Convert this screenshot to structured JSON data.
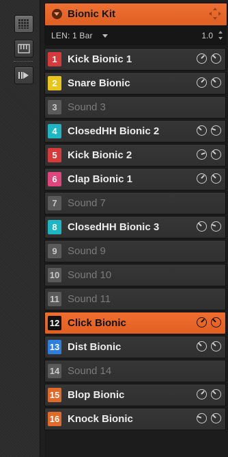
{
  "rail": {
    "buttons": [
      {
        "icon": "grid-icon",
        "active": true
      },
      {
        "icon": "keyboard-icon",
        "active": false
      },
      {
        "icon": "step-sequencer-icon",
        "active": false
      }
    ]
  },
  "header": {
    "title": "Bionic Kit",
    "expand_icon": "chevron-down-icon",
    "move_icon": "move-icon"
  },
  "lenbar": {
    "len_label": "LEN: 1 Bar",
    "value": "1.0"
  },
  "colors": {
    "accent": "#e6672a",
    "red": "#d63a3a",
    "yellow": "#e7c51d",
    "gray": "#5a5a5a",
    "cyan": "#1fb6c4",
    "pink": "#e0457c",
    "black": "#111111",
    "blue": "#2e7ee0",
    "orange": "#e06a2a"
  },
  "pads": [
    {
      "num": "1",
      "name": "Kick Bionic 1",
      "color": "#d63a3a",
      "empty": false,
      "selected": false
    },
    {
      "num": "2",
      "name": "Snare Bionic",
      "color": "#e7c51d",
      "empty": false,
      "selected": false
    },
    {
      "num": "3",
      "name": "Sound 3",
      "color": "#5a5a5a",
      "empty": true,
      "selected": false
    },
    {
      "num": "4",
      "name": "ClosedHH Bionic 2",
      "color": "#1fb6c4",
      "empty": false,
      "selected": false
    },
    {
      "num": "5",
      "name": "Kick Bionic 2",
      "color": "#d63a3a",
      "empty": false,
      "selected": false
    },
    {
      "num": "6",
      "name": "Clap Bionic 1",
      "color": "#e0457c",
      "empty": false,
      "selected": false
    },
    {
      "num": "7",
      "name": "Sound 7",
      "color": "#5a5a5a",
      "empty": true,
      "selected": false
    },
    {
      "num": "8",
      "name": "ClosedHH Bionic 3",
      "color": "#1fb6c4",
      "empty": false,
      "selected": false
    },
    {
      "num": "9",
      "name": "Sound 9",
      "color": "#5a5a5a",
      "empty": true,
      "selected": false
    },
    {
      "num": "10",
      "name": "Sound 10",
      "color": "#5a5a5a",
      "empty": true,
      "selected": false
    },
    {
      "num": "11",
      "name": "Sound 11",
      "color": "#5a5a5a",
      "empty": true,
      "selected": false
    },
    {
      "num": "12",
      "name": "Click Bionic",
      "color": "#111111",
      "empty": false,
      "selected": true
    },
    {
      "num": "13",
      "name": "Dist Bionic",
      "color": "#2e7ee0",
      "empty": false,
      "selected": false
    },
    {
      "num": "14",
      "name": "Sound 14",
      "color": "#5a5a5a",
      "empty": true,
      "selected": false
    },
    {
      "num": "15",
      "name": "Blop Bionic",
      "color": "#e06a2a",
      "empty": false,
      "selected": false
    },
    {
      "num": "16",
      "name": "Knock Bionic",
      "color": "#e06a2a",
      "empty": false,
      "selected": false
    }
  ]
}
